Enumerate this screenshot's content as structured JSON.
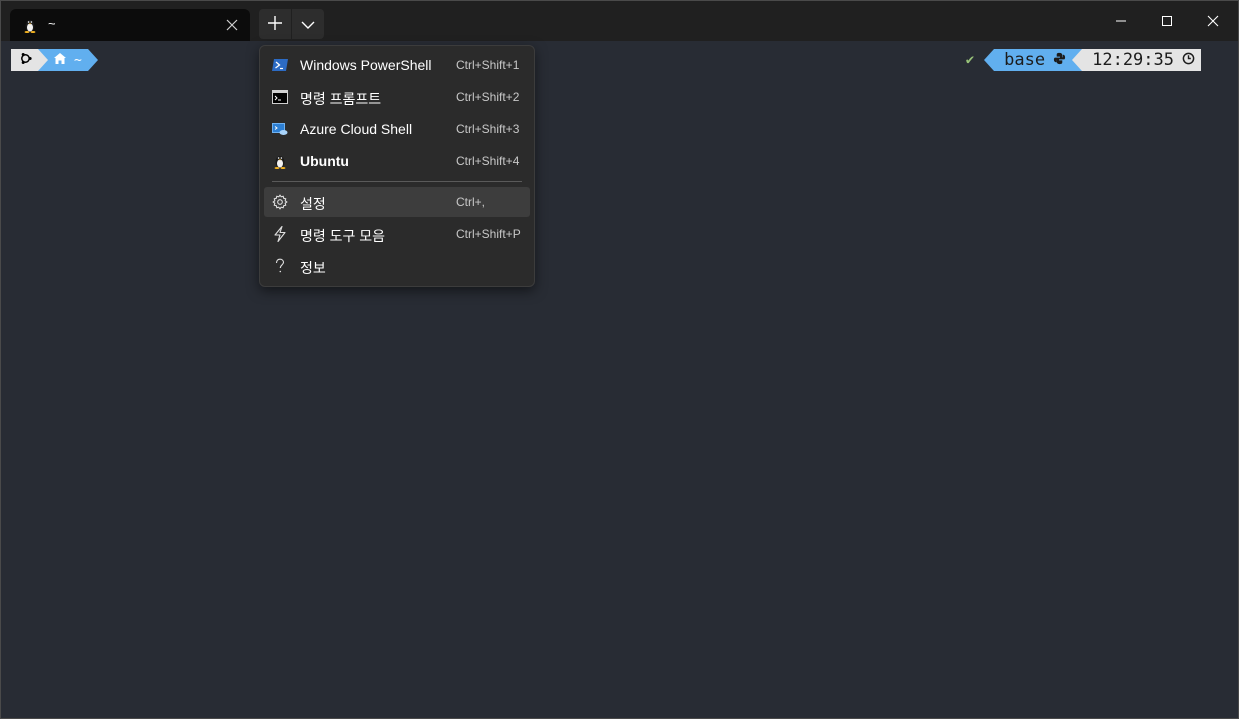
{
  "tab": {
    "title": "~",
    "icon": "linux-penguin-icon"
  },
  "titlebar": {
    "new_tab_icon": "plus-icon",
    "dropdown_icon": "chevron-down-icon"
  },
  "prompt": {
    "os_icon": "ubuntu-icon",
    "home_icon": "home-icon",
    "path": "~",
    "status_check": "✔",
    "env": "base",
    "env_icon": "python-icon",
    "time": "12:29:35",
    "clock_icon": "clock-icon"
  },
  "colors": {
    "background": "#282c34",
    "accent": "#61afef",
    "segment_light": "#e4e4e4",
    "check": "#98c379"
  },
  "menu": {
    "profiles": [
      {
        "label": "Windows PowerShell",
        "shortcut": "Ctrl+Shift+1",
        "icon": "powershell-icon"
      },
      {
        "label": "명령 프롬프트",
        "shortcut": "Ctrl+Shift+2",
        "icon": "command-prompt-icon"
      },
      {
        "label": "Azure Cloud Shell",
        "shortcut": "Ctrl+Shift+3",
        "icon": "azure-cloud-shell-icon"
      },
      {
        "label": "Ubuntu",
        "shortcut": "Ctrl+Shift+4",
        "icon": "linux-penguin-icon"
      }
    ],
    "actions": [
      {
        "label": "설정",
        "shortcut": "Ctrl+,",
        "icon": "gear-icon"
      },
      {
        "label": "명령 도구 모음",
        "shortcut": "Ctrl+Shift+P",
        "icon": "lightning-icon"
      },
      {
        "label": "정보",
        "shortcut": "",
        "icon": "question-icon"
      }
    ]
  }
}
